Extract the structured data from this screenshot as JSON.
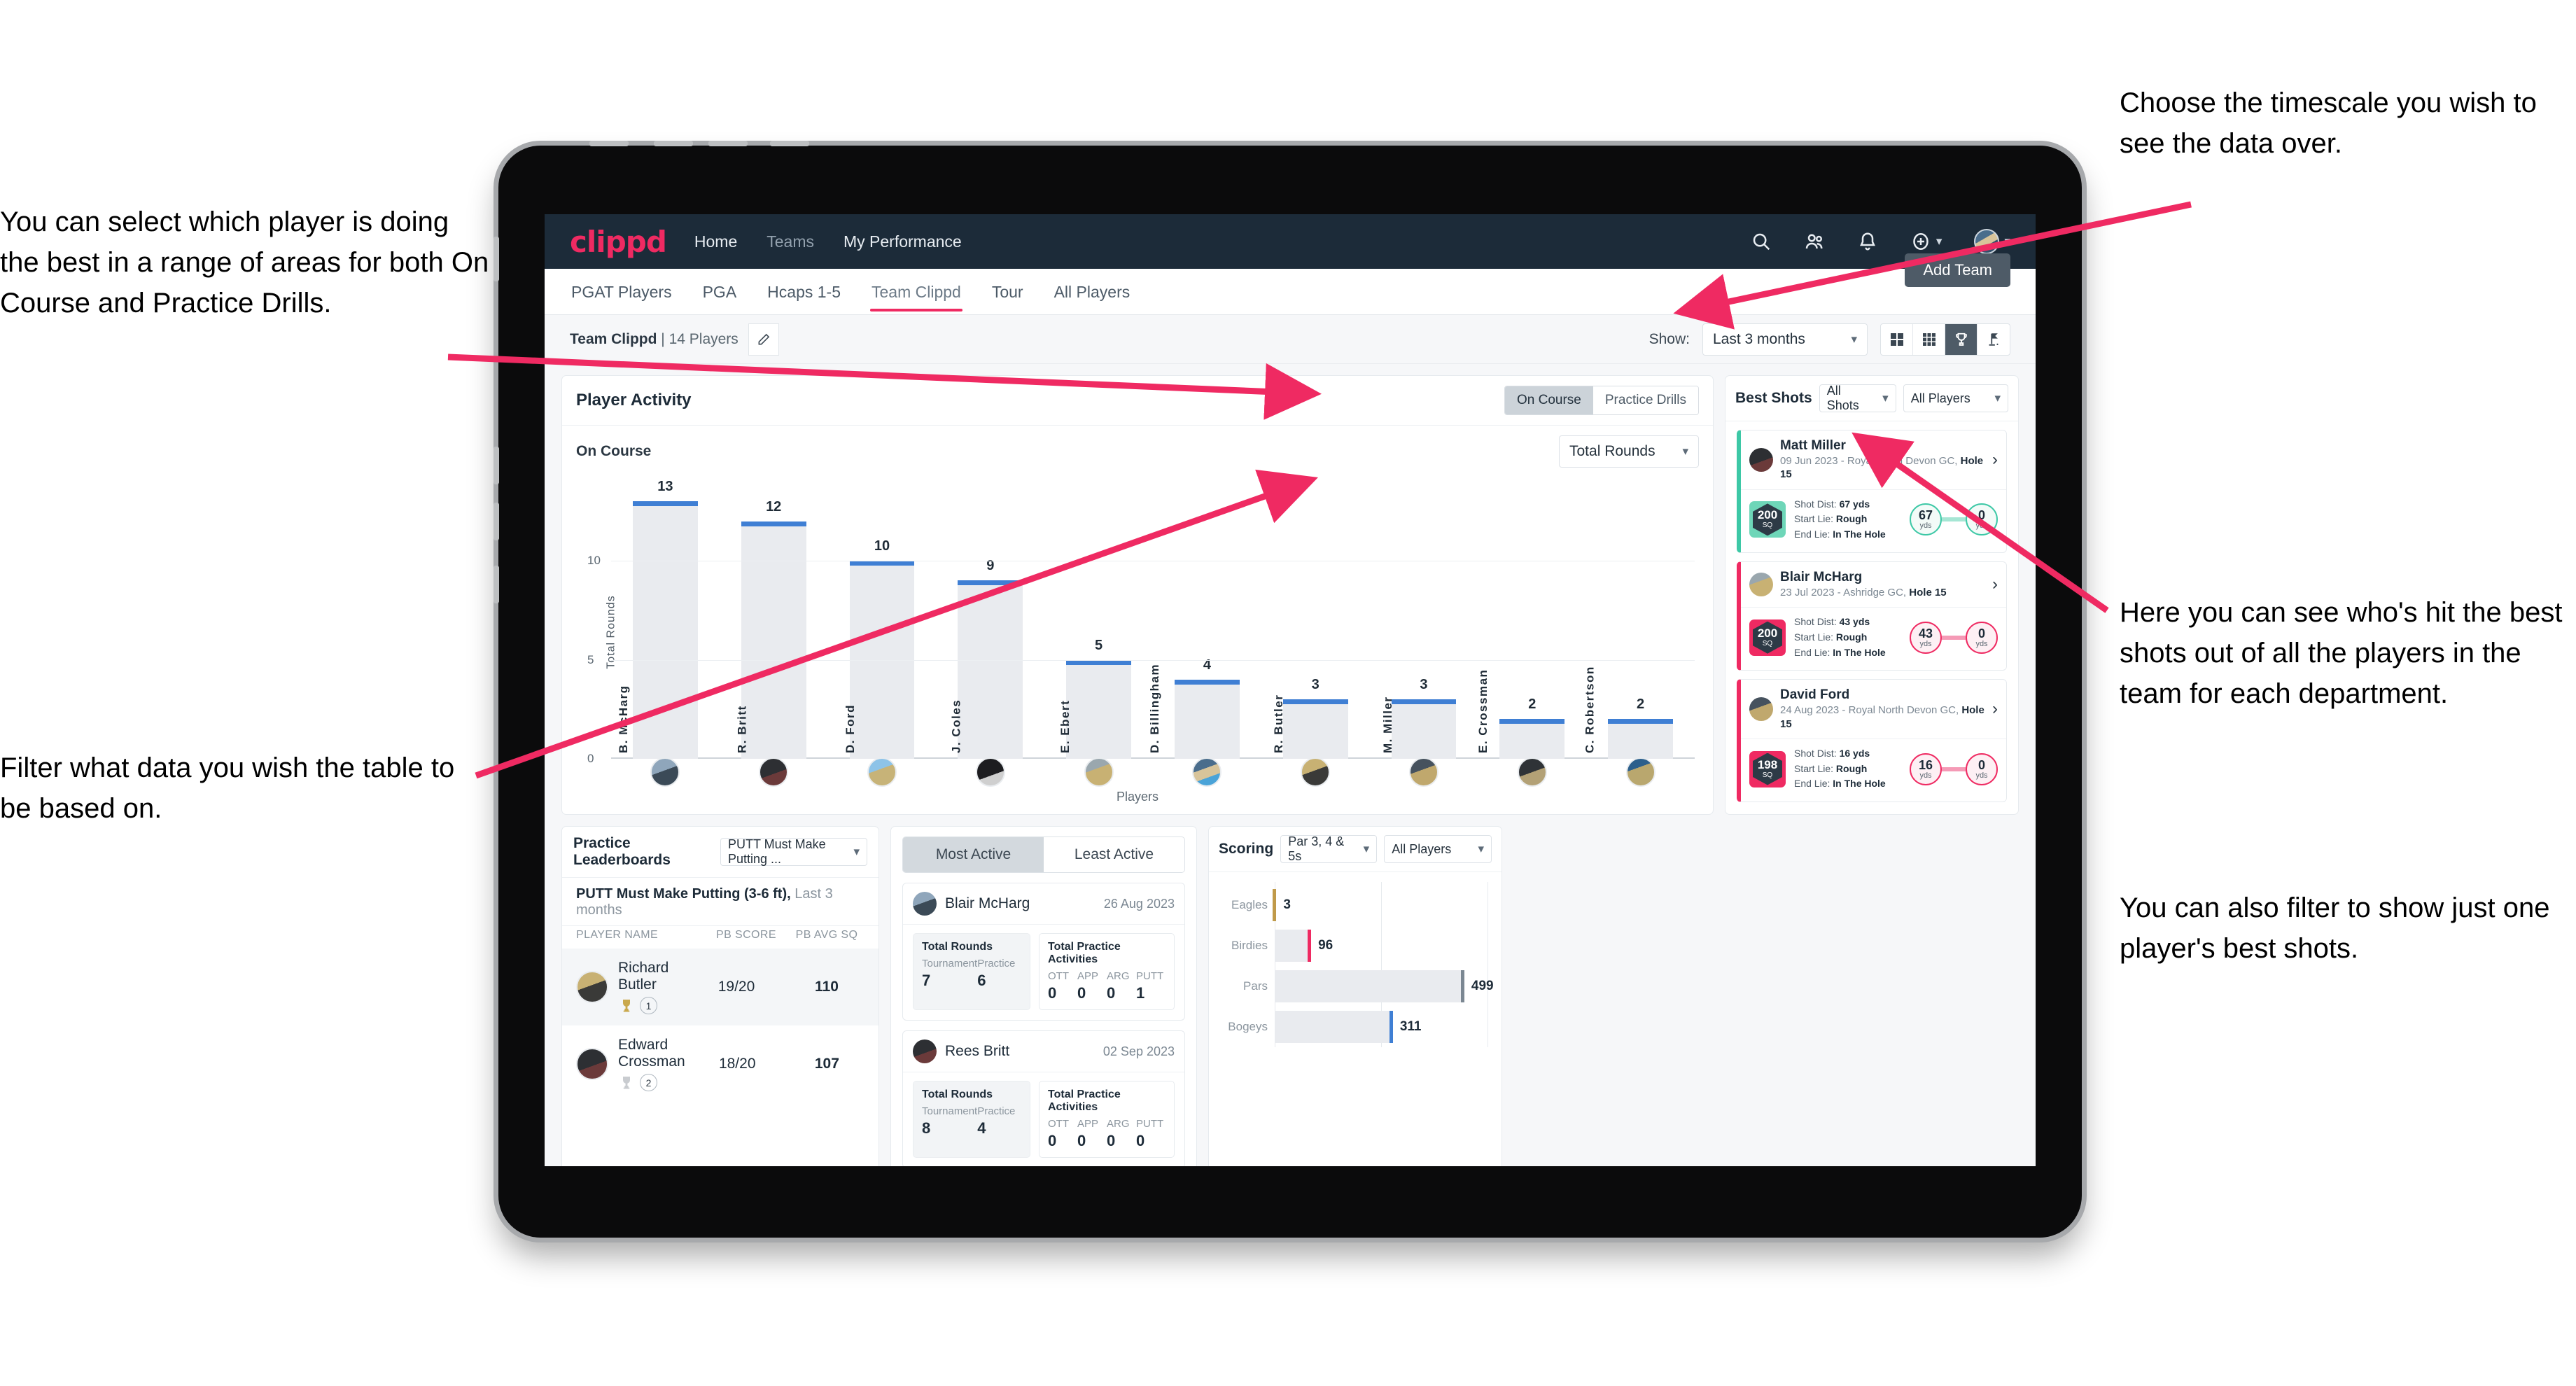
{
  "annotations": {
    "top_left": "You can select which player is doing the best in a range of areas for both On Course and Practice Drills.",
    "bottom_left": "Filter what data you wish the table to be based on.",
    "top_right": "Choose the timescale you wish to see the data over.",
    "mid_right": "Here you can see who's hit the best shots out of all the players in the team for each department.",
    "mid_right_2": "You can also filter to show just one player's best shots."
  },
  "navbar": {
    "logo": "clippd",
    "links": [
      {
        "label": "Home",
        "active": true
      },
      {
        "label": "Teams",
        "active": false
      },
      {
        "label": "My Performance",
        "active": true
      }
    ],
    "icons": [
      "search-icon",
      "people-icon",
      "bell-icon",
      "plus-circle-icon",
      "avatar"
    ]
  },
  "tabs": [
    {
      "label": "PGAT Players",
      "active": false
    },
    {
      "label": "PGA",
      "active": false
    },
    {
      "label": "Hcaps 1-5",
      "active": false
    },
    {
      "label": "Team Clippd",
      "active": true
    },
    {
      "label": "Tour",
      "active": false
    },
    {
      "label": "All Players",
      "active": false
    }
  ],
  "add_team_button": "Add Team",
  "filterbar": {
    "team_name": "Team Clippd",
    "team_players": " | 14 Players",
    "show_label": "Show:",
    "timescale_value": "Last 3 months",
    "views": [
      "grid-2x2-icon",
      "grid-3x3-icon",
      "trophy-icon",
      "golf-flag-icon"
    ],
    "active_view": "trophy-icon"
  },
  "player_activity": {
    "title": "Player Activity",
    "segments": [
      {
        "label": "On Course",
        "active": true
      },
      {
        "label": "Practice Drills",
        "active": false
      }
    ],
    "sub_label": "On Course",
    "metric_select": "Total Rounds"
  },
  "chart_data": {
    "type": "bar",
    "title": "Player Activity",
    "xlabel": "Players",
    "ylabel": "Total Rounds",
    "ylim": [
      0,
      14
    ],
    "yticks": [
      0,
      5,
      10
    ],
    "grid": true,
    "categories": [
      "B. McHarg",
      "R. Britt",
      "D. Ford",
      "J. Coles",
      "E. Ebert",
      "D. Billingham",
      "R. Butler",
      "M. Miller",
      "E. Crossman",
      "C. Robertson"
    ],
    "values": [
      13,
      12,
      10,
      9,
      5,
      4,
      3,
      3,
      2,
      2
    ],
    "bar_color": "#e9ebef",
    "cap_color": "#3f7fd4"
  },
  "best_shots": {
    "title": "Best Shots",
    "filter_shots": "All Shots",
    "filter_players": "All Players",
    "shots": [
      {
        "player": "Matt Miller",
        "meta_prefix": "09 Jun 2023 - Royal North Devon GC, ",
        "hole": "Hole 15",
        "badge_number": "200",
        "badge_unit": "SQ",
        "shot_dist_label": "Shot Dist: ",
        "shot_dist": "67 yds",
        "start_lie_label": "Start Lie: ",
        "start_lie": "Rough",
        "end_lie_label": "End Lie: ",
        "end_lie": "In The Hole",
        "from_value": "67",
        "from_unit": "yds",
        "to_value": "0",
        "to_unit": "yds",
        "accent": "#3dc8a6"
      },
      {
        "player": "Blair McHarg",
        "meta_prefix": "23 Jul 2023 - Ashridge GC, ",
        "hole": "Hole 15",
        "badge_number": "200",
        "badge_unit": "SQ",
        "shot_dist_label": "Shot Dist: ",
        "shot_dist": "43 yds",
        "start_lie_label": "Start Lie: ",
        "start_lie": "Rough",
        "end_lie_label": "End Lie: ",
        "end_lie": "In The Hole",
        "from_value": "43",
        "from_unit": "yds",
        "to_value": "0",
        "to_unit": "yds",
        "accent": "#ef2a62"
      },
      {
        "player": "David Ford",
        "meta_prefix": "24 Aug 2023 - Royal North Devon GC, ",
        "hole": "Hole 15",
        "badge_number": "198",
        "badge_unit": "SQ",
        "shot_dist_label": "Shot Dist: ",
        "shot_dist": "16 yds",
        "start_lie_label": "Start Lie: ",
        "start_lie": "Rough",
        "end_lie_label": "End Lie: ",
        "end_lie": "In The Hole",
        "from_value": "16",
        "from_unit": "yds",
        "to_value": "0",
        "to_unit": "yds",
        "accent": "#ef2a62"
      }
    ]
  },
  "practice_leaderboards": {
    "title": "Practice Leaderboards",
    "drill_select": "PUTT Must Make Putting ...",
    "sub_bold": "PUTT Must Make Putting (3-6 ft),",
    "sub_rest": " Last 3 months",
    "columns": [
      "PLAYER NAME",
      "PB SCORE",
      "PB AVG SQ"
    ],
    "rows": [
      {
        "name": "Richard Butler",
        "rank": "1",
        "trophy": "gold",
        "pb_score": "19/20",
        "pb_avg_sq": "110"
      },
      {
        "name": "Edward Crossman",
        "rank": "2",
        "trophy": "silver",
        "pb_score": "18/20",
        "pb_avg_sq": "107"
      }
    ]
  },
  "activity_panel": {
    "tabs": [
      {
        "label": "Most Active",
        "active": true
      },
      {
        "label": "Least Active",
        "active": false
      }
    ],
    "items": [
      {
        "name": "Blair McHarg",
        "date": "26 Aug 2023",
        "rounds_title": "Total Rounds",
        "rounds_keys": [
          "Tournament",
          "Practice"
        ],
        "rounds_values": [
          "7",
          "6"
        ],
        "practice_title": "Total Practice Activities",
        "practice_keys": [
          "OTT",
          "APP",
          "ARG",
          "PUTT"
        ],
        "practice_values": [
          "0",
          "0",
          "0",
          "1"
        ]
      },
      {
        "name": "Rees Britt",
        "date": "02 Sep 2023",
        "rounds_title": "Total Rounds",
        "rounds_keys": [
          "Tournament",
          "Practice"
        ],
        "rounds_values": [
          "8",
          "4"
        ],
        "practice_title": "Total Practice Activities",
        "practice_keys": [
          "OTT",
          "APP",
          "ARG",
          "PUTT"
        ],
        "practice_values": [
          "0",
          "0",
          "0",
          "0"
        ]
      }
    ]
  },
  "scoring": {
    "title": "Scoring",
    "filter_par": "Par 3, 4 & 5s",
    "filter_players": "All Players",
    "chart": {
      "type": "bar",
      "orientation": "horizontal",
      "categories": [
        "Eagles",
        "Birdies",
        "Pars",
        "Bogeys"
      ],
      "values": [
        3,
        96,
        499,
        311
      ],
      "xlim": [
        0,
        560
      ],
      "colors": [
        "#c09a4a",
        "#ef2a62",
        "#7b8792",
        "#3f7fd4"
      ],
      "title": "Scoring"
    }
  }
}
